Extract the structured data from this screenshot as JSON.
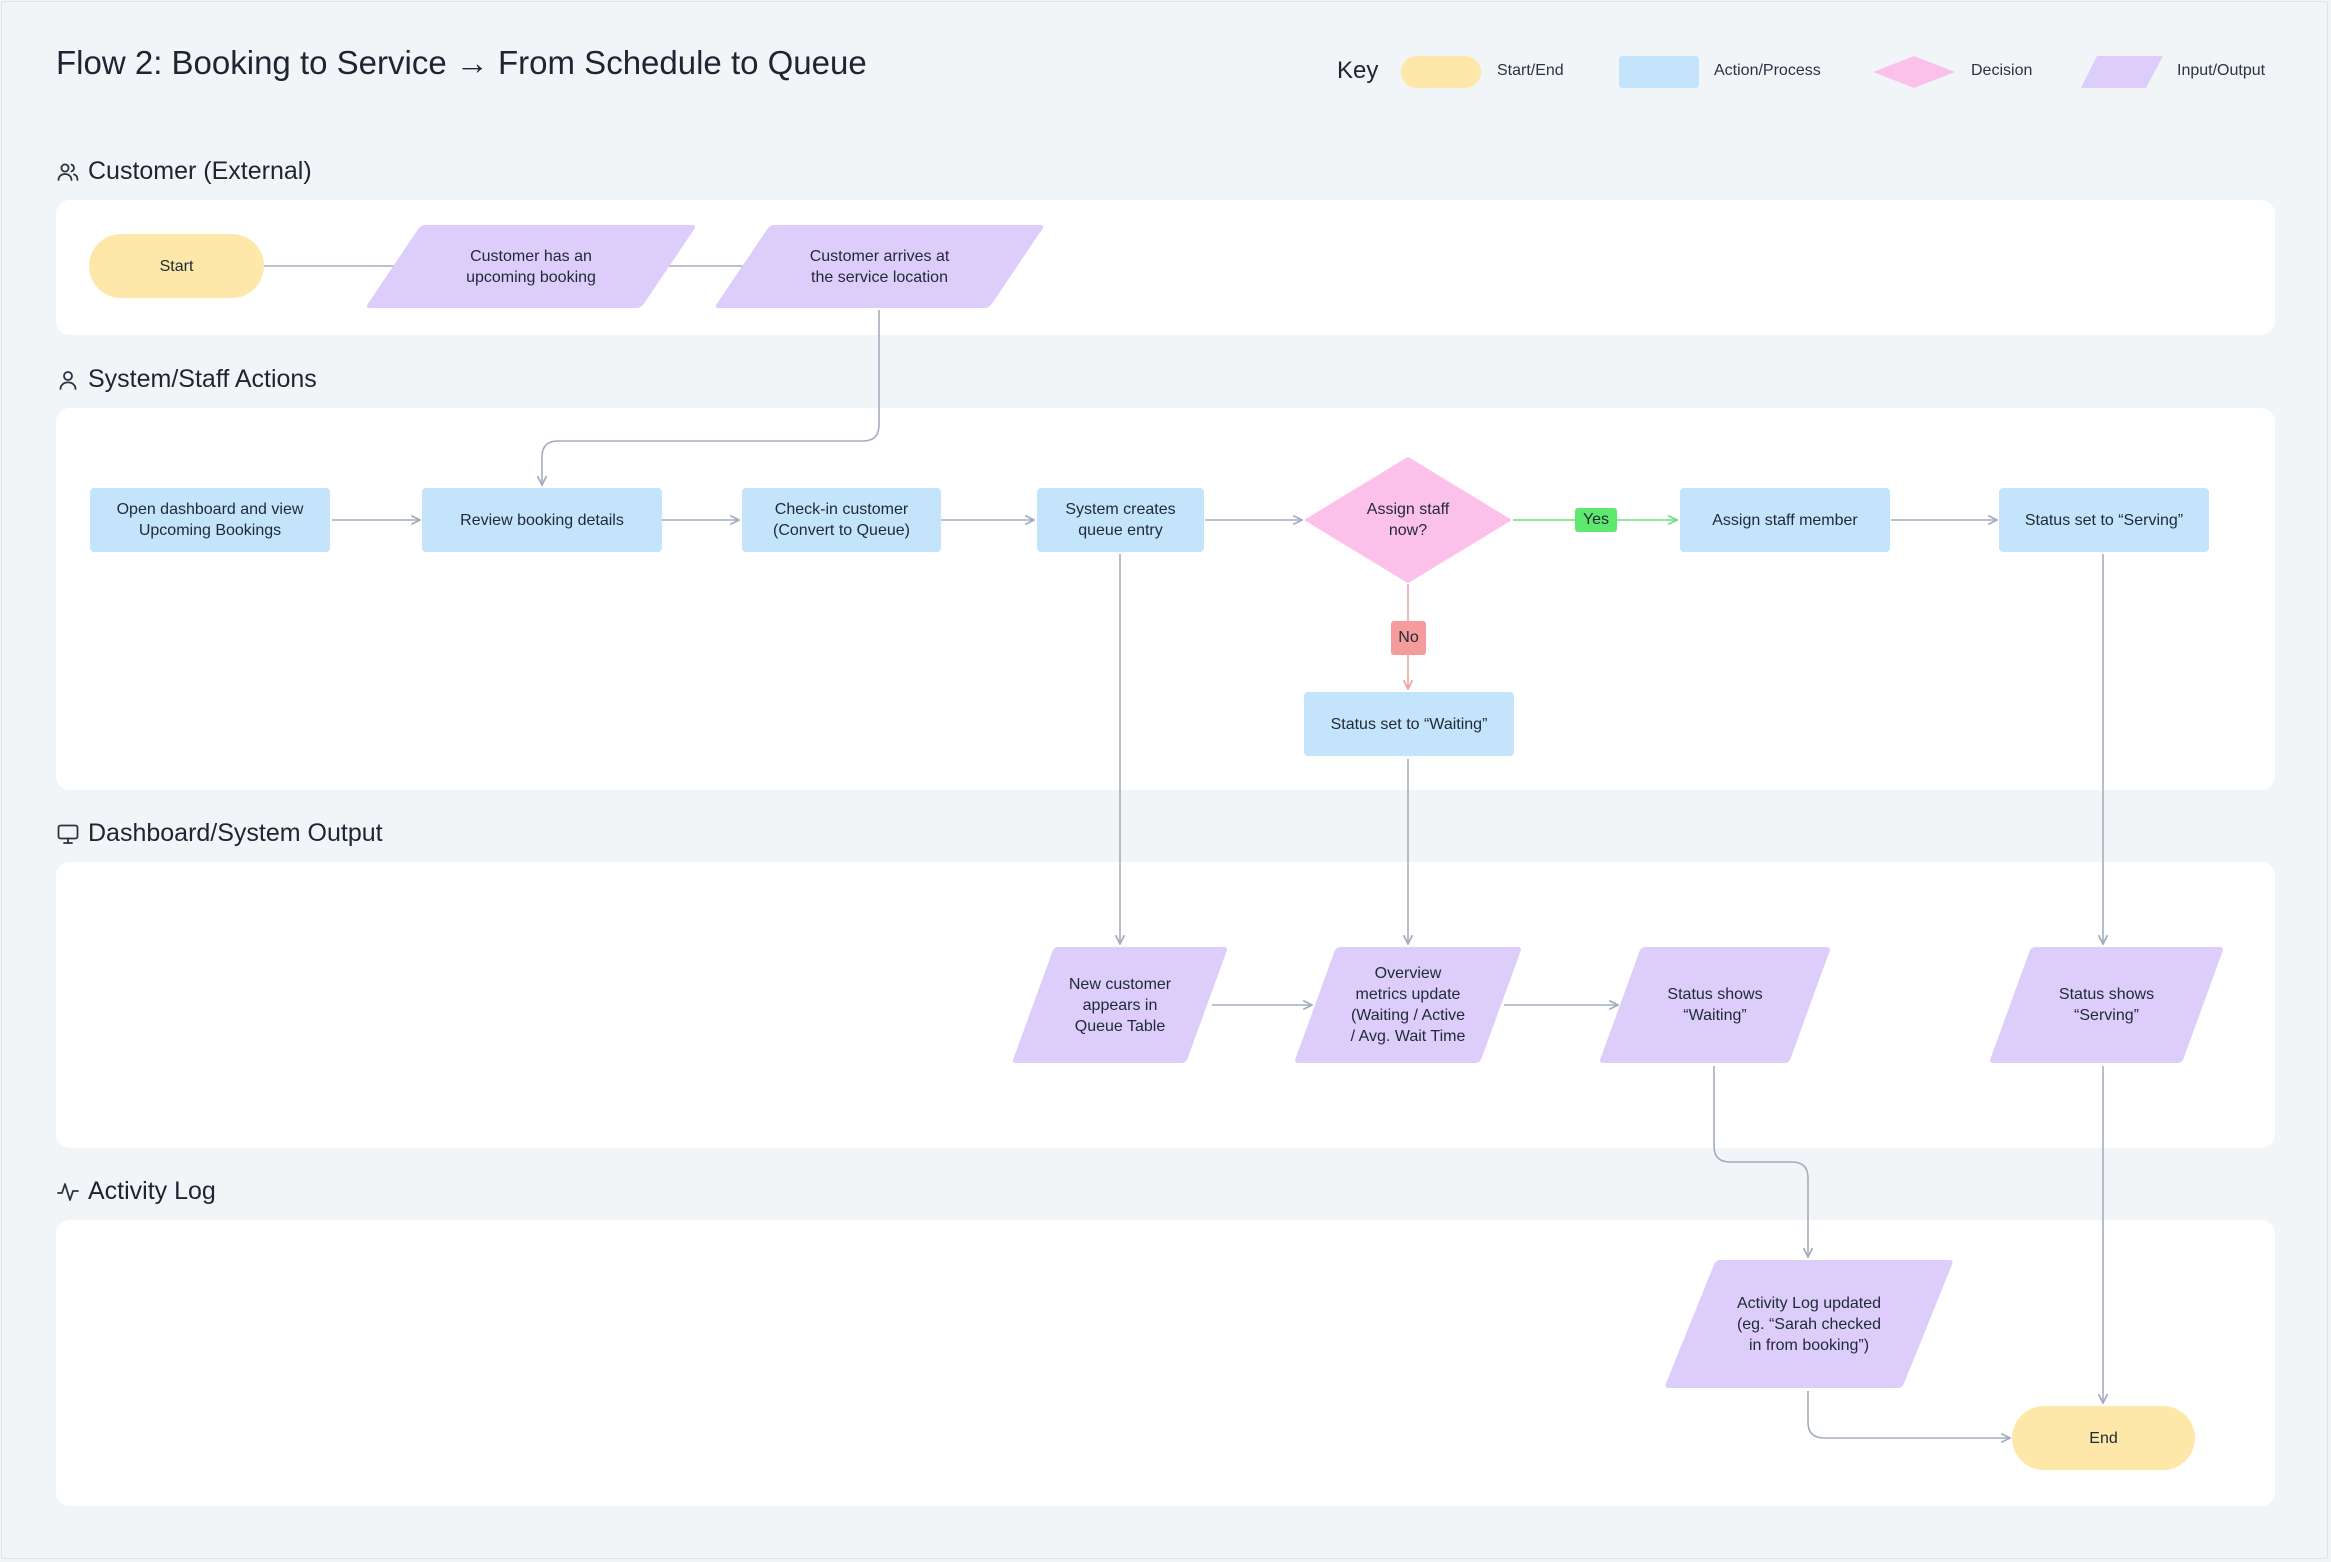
{
  "title": "Flow 2: Booking to Service → From Schedule to Queue",
  "key": {
    "title": "Key",
    "items": [
      {
        "label": "Start/End",
        "color": "#fde7a9",
        "shape": "terminal"
      },
      {
        "label": "Action/Process",
        "color": "#c4e4fb",
        "shape": "process"
      },
      {
        "label": "Decision",
        "color": "#fcc1ea",
        "shape": "decision"
      },
      {
        "label": "Input/Output",
        "color": "#dccdfb",
        "shape": "io"
      }
    ]
  },
  "lanes": [
    {
      "title": "Customer (External)",
      "icon": "users-icon"
    },
    {
      "title": "System/Staff Actions",
      "icon": "user-icon"
    },
    {
      "title": "Dashboard/System Output",
      "icon": "monitor-icon"
    },
    {
      "title": "Activity Log",
      "icon": "activity-icon"
    }
  ],
  "nodes": {
    "start": "Start",
    "has_booking": "Customer has an\nupcoming booking",
    "arrives": "Customer arrives at\nthe service location",
    "open_dashboard": "Open dashboard and view\nUpcoming Bookings",
    "review": "Review booking details",
    "checkin": "Check-in customer\n(Convert to Queue)",
    "queue_entry": "System creates\nqueue entry",
    "assign_decision": "Assign staff\nnow?",
    "assign_staff": "Assign staff member",
    "status_serving": "Status set to “Serving”",
    "status_waiting": "Status set to “Waiting”",
    "new_customer": "New customer\nappears in\nQueue Table",
    "overview": "Overview\nmetrics update\n(Waiting / Active\n/ Avg. Wait Time",
    "shows_waiting": "Status shows\n“Waiting”",
    "shows_serving": "Status shows\n“Serving”",
    "activity_log": "Activity Log updated\n(eg. “Sarah checked\nin from booking”)",
    "end": "End"
  },
  "edge_labels": {
    "yes": "Yes",
    "no": "No"
  },
  "colors": {
    "background": "#f2f5f8",
    "lane": "#ffffff",
    "connector": "#a3adbd",
    "yes": "#6fe07c",
    "yes_badge": "#5ee86f",
    "no": "#f0a3a3",
    "no_badge": "#f59b9b"
  }
}
